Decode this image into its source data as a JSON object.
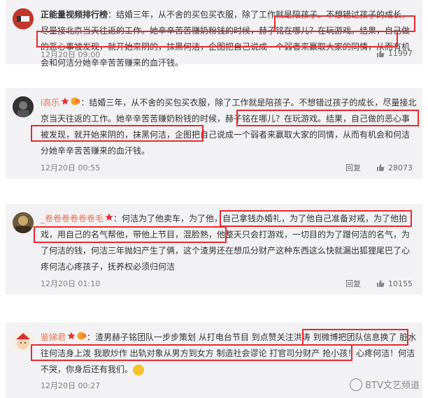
{
  "comments": [
    {
      "username": "正能量视频排行榜",
      "text": "：结婚三年，从不舍的买包买衣服，除了工作就是陪孩子。不想错过孩子的成长，尽量接北京当天往返的工作。她辛辛苦苦赚奶粉钱的时候，赫子铭在哪儿？在玩游戏。结果，自己做的恶心事被发现，就开始来阴的，抹黑何洁，企图把自己说成一个弱者来赢取大家的同情，从而有机会和何洁分她辛辛苦苦赚来的血汗钱。",
      "time": "12月20日 09:00",
      "likes": "11997"
    },
    {
      "username": "i高乐",
      "text": "：结婚三年，从不舍的买包买衣服，除了工作就是陪孩子。不想错过孩子的成长，尽量接北京当天往返的工作。她辛辛苦苦赚奶粉钱的时候，赫子铭在哪儿？在玩游戏。结果，自己做的恶心事被发现，就开始来阴的，抹黑何洁，企图把自己说成一个弱者来赢取大家的同情，从而有机会和何洁分她辛辛苦苦赚来的血汗钱。",
      "time": "12月20日 00:55",
      "reply": "回复",
      "likes": "28073"
    },
    {
      "username": "_卷卷卷卷卷卷毛",
      "text": "：何洁为了他卖车，为了他，自己拿钱办婚礼，为了他自己准备对戒，为了他拍戏，用自己的名气帮他，带他上节目，混脸熟，他整天只会打游戏，一切目的为了蹭何洁的名气，为了何洁的钱，何洁三年抛妇产生了俩，这个渣男还在想瓜分财产这种东西这么快就漏出狐狸尾巴了心疼何洁心疼孩子，抚养权必须归何洁",
      "time": "12月20日 01:10",
      "reply": "回复",
      "likes": "10155"
    },
    {
      "username": "鉴娣君",
      "text": "：渣男赫子铭团队一步步策划 从打电台节目 到点赞关注洪涛 到微博把团队信息换了 脏水往何洁身上泼 我歌炒作 出轨对象从男方到女方 制造社会谬论 打官司分财产 抢小孩！心疼何洁！何洁不哭，你身后还有我们。",
      "time": "12月20日 00:27",
      "reply": "回复"
    }
  ],
  "watermark": "BTV文艺频道"
}
